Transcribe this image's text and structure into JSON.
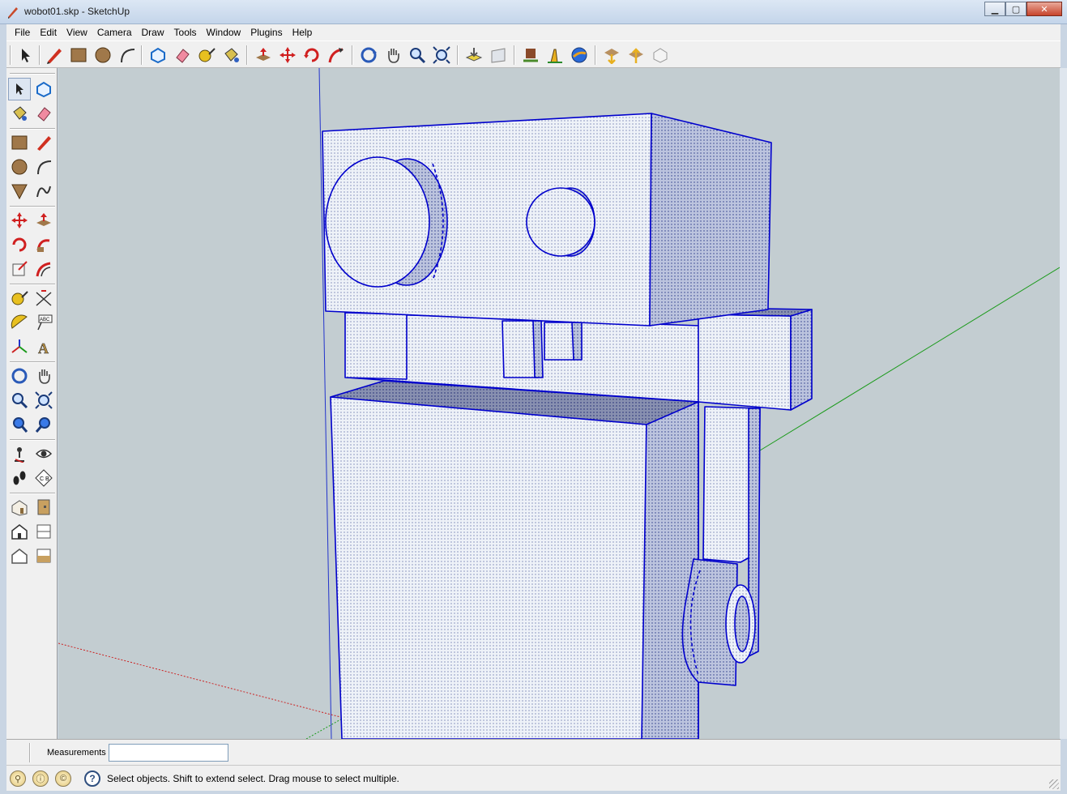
{
  "window": {
    "title": "wobot01.skp - SketchUp",
    "minimize_label": "▁",
    "maximize_label": "▢",
    "close_label": "✕"
  },
  "menu": {
    "items": [
      {
        "name": "menu-file",
        "label": "File"
      },
      {
        "name": "menu-edit",
        "label": "Edit"
      },
      {
        "name": "menu-view",
        "label": "View"
      },
      {
        "name": "menu-camera",
        "label": "Camera"
      },
      {
        "name": "menu-draw",
        "label": "Draw"
      },
      {
        "name": "menu-tools",
        "label": "Tools"
      },
      {
        "name": "menu-window",
        "label": "Window"
      },
      {
        "name": "menu-plugins",
        "label": "Plugins"
      },
      {
        "name": "menu-help",
        "label": "Help"
      }
    ]
  },
  "toolbar_icons": [
    "select-icon",
    "pencil-icon",
    "rectangle-icon",
    "circle-icon",
    "arc-icon",
    "make-component-icon",
    "eraser-icon",
    "tape-measure-icon",
    "paint-bucket-icon",
    "push-pull-icon",
    "move-icon",
    "rotate-icon",
    "follow-me-icon",
    "orbit-icon",
    "pan-icon",
    "zoom-icon",
    "zoom-extents-icon",
    "get-models-icon",
    "share-model-icon",
    "place-model-icon",
    "add-location-icon",
    "toggle-terrain-icon",
    "google-earth-icon",
    "get-models-warehouse-icon",
    "upload-icon",
    "component-icon"
  ],
  "measurements": {
    "label": "Measurements",
    "value": ""
  },
  "status": {
    "text": "Select objects. Shift to extend select. Drag mouse to select multiple.",
    "help_glyph": "?",
    "icon1_glyph": "⚲",
    "icon2_glyph": "ⓘ",
    "icon3_glyph": "©"
  },
  "colors": {
    "selection": "#0000cc",
    "viewport": "#c3cdd1",
    "face_front": "#e8eef5",
    "face_side": "#b9c3dc",
    "face_dark": "#8a92b0",
    "axis_green": "#1a9a1a",
    "axis_red": "#cc2222",
    "axis_blue": "#2233cc"
  }
}
